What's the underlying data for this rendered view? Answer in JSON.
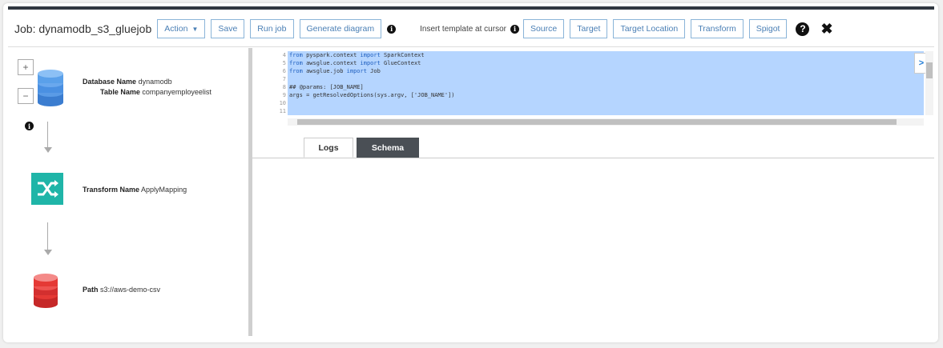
{
  "toolbar": {
    "job_title": "Job: dynamodb_s3_gluejob",
    "action_label": "Action",
    "save_label": "Save",
    "run_job_label": "Run job",
    "generate_diagram_label": "Generate diagram",
    "insert_template_label": "Insert template at cursor",
    "source_label": "Source",
    "target_label": "Target",
    "target_location_label": "Target Location",
    "transform_label": "Transform",
    "spigot_label": "Spigot"
  },
  "diagram": {
    "source_node": {
      "db_name_key": "Database Name",
      "db_name_value": "dynamodb",
      "table_name_key": "Table Name",
      "table_name_value": "companyemployeelist"
    },
    "transform_node": {
      "name_key": "Transform Name",
      "name_value": "ApplyMapping"
    },
    "target_node": {
      "path_key": "Path",
      "path_value": "s3://aws-demo-csv"
    },
    "zoom_in": "+",
    "zoom_out": "−"
  },
  "editor": {
    "line_numbers": [
      "4",
      "5",
      "6",
      "7",
      "8",
      "9",
      "10",
      "11"
    ],
    "lines": [
      {
        "kw1": "from",
        "mid": " pyspark.context ",
        "kw2": "import",
        "tail": " SparkContext"
      },
      {
        "kw1": "from",
        "mid": " awsglue.context ",
        "kw2": "import",
        "tail": " GlueContext"
      },
      {
        "kw1": "from",
        "mid": " awsglue.job ",
        "kw2": "import",
        "tail": " Job"
      },
      {
        "kw1": "",
        "mid": "",
        "kw2": "",
        "tail": ""
      },
      {
        "kw1": "",
        "mid": "## @params: [JOB_NAME]",
        "kw2": "",
        "tail": ""
      },
      {
        "kw1": "",
        "mid": "args = getResolvedOptions(sys.argv, ['JOB_NAME'])",
        "kw2": "",
        "tail": ""
      },
      {
        "kw1": "",
        "mid": "",
        "kw2": "",
        "tail": ""
      },
      {
        "kw1": "",
        "mid": "",
        "kw2": "",
        "tail": ""
      }
    ]
  },
  "tabs": {
    "logs_label": "Logs",
    "schema_label": "Schema"
  },
  "colors": {
    "dynamodb_blue": "#4a90e2",
    "transform_teal": "#1fb5a8",
    "s3_red": "#e53935",
    "selection": "#b5d5ff"
  }
}
